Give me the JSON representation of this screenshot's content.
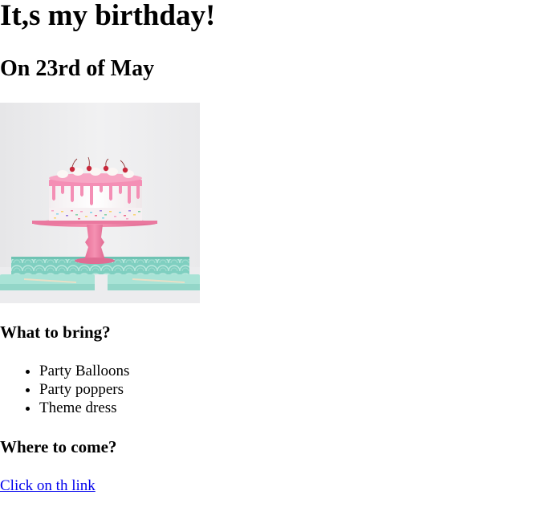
{
  "page": {
    "title": "It,s my birthday!",
    "date_heading": "On 23rd of May"
  },
  "image": {
    "subject": "cake-photo"
  },
  "bring": {
    "heading": "What to bring?",
    "items": [
      "Party Balloons",
      "Party poppers",
      "Theme dress"
    ]
  },
  "where": {
    "heading": "Where to come?",
    "link_text": "Click on th link"
  },
  "colors": {
    "link": "#0000ee",
    "text": "#000000",
    "background": "#ffffff"
  }
}
